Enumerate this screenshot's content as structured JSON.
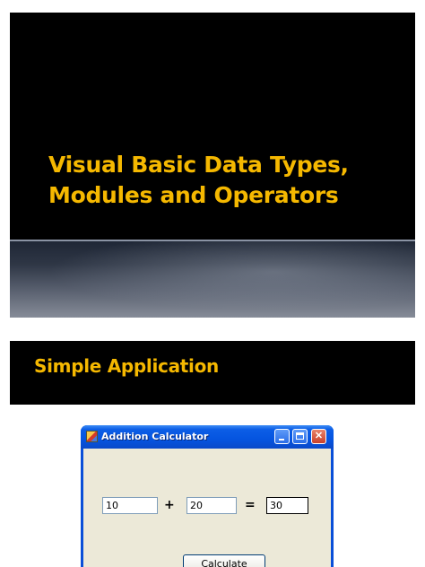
{
  "slide1": {
    "title": "Visual Basic  Data Types,\nModules and Operators"
  },
  "slide2": {
    "title": "Simple Application"
  },
  "window": {
    "title": "Addition Calculator",
    "inputs": {
      "first_value": "10",
      "second_value": "20",
      "result_value": "30"
    },
    "operators": {
      "plus": "+",
      "equals": "="
    },
    "calculate_label": "Calculate"
  },
  "colors": {
    "title_accent": "#f5b800",
    "xp_titlebar": "#0554e0",
    "dialog_face": "#ece9d8"
  }
}
